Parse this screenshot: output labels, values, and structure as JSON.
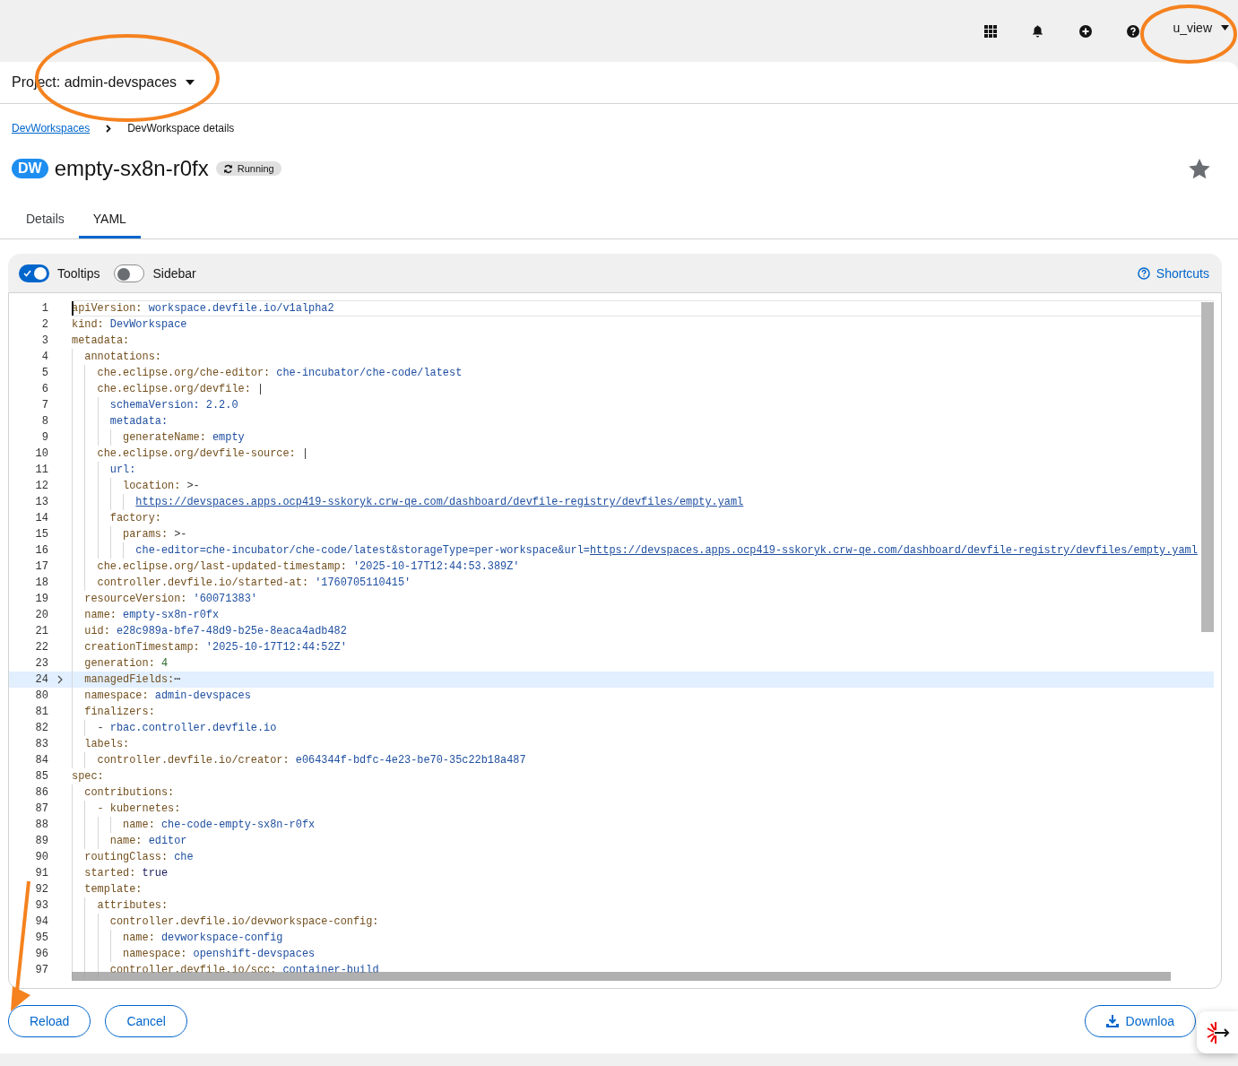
{
  "masthead": {
    "user": "u_view"
  },
  "project": {
    "label": "Project: admin-devspaces"
  },
  "breadcrumb": [
    {
      "label": "DevWorkspaces",
      "kind": "link"
    },
    {
      "label": "DevWorkspace details",
      "kind": "current"
    }
  ],
  "header": {
    "badge": "DW",
    "title": "empty-sx8n-r0fx",
    "status": "Running",
    "favorite": false
  },
  "tabs": [
    {
      "label": "Details",
      "selected": false
    },
    {
      "label": "YAML",
      "selected": true
    }
  ],
  "toolbar": {
    "toggles": [
      {
        "label": "Tooltips",
        "on": true
      },
      {
        "label": "Sidebar",
        "on": false
      }
    ],
    "shortcuts": "Shortcuts"
  },
  "editor": {
    "lines": [
      {
        "number": "1",
        "selected": true,
        "parts": [
          {
            "text": "apiVersion: ",
            "kind": "key"
          },
          {
            "text": "workspace.devfile.io/v1alpha2",
            "kind": "str"
          }
        ]
      },
      {
        "number": "2",
        "selected": false,
        "parts": [
          {
            "text": "kind: ",
            "kind": "key"
          },
          {
            "text": "DevWorkspace",
            "kind": "str"
          }
        ]
      },
      {
        "number": "3",
        "selected": false,
        "parts": [
          {
            "text": "metadata:",
            "kind": "key"
          }
        ]
      },
      {
        "number": "4",
        "selected": false,
        "parts": [
          {
            "text": "  annotations:",
            "kind": "key"
          }
        ]
      },
      {
        "number": "5",
        "selected": false,
        "parts": [
          {
            "text": "    che.eclipse.org/che-editor: ",
            "kind": "key"
          },
          {
            "text": "che-incubator/che-code/latest",
            "kind": "str"
          }
        ]
      },
      {
        "number": "6",
        "selected": false,
        "parts": [
          {
            "text": "    che.eclipse.org/devfile: ",
            "kind": "key"
          },
          {
            "text": "|",
            "kind": "plain"
          }
        ]
      },
      {
        "number": "7",
        "selected": false,
        "parts": [
          {
            "text": "      schemaVersion: 2.2.0",
            "kind": "str"
          }
        ]
      },
      {
        "number": "8",
        "selected": false,
        "parts": [
          {
            "text": "      metadata:",
            "kind": "str"
          }
        ]
      },
      {
        "number": "9",
        "selected": false,
        "parts": [
          {
            "text": "        generateName: ",
            "kind": "key"
          },
          {
            "text": "empty",
            "kind": "str"
          }
        ]
      },
      {
        "number": "10",
        "selected": false,
        "parts": [
          {
            "text": "    che.eclipse.org/devfile-source: ",
            "kind": "key"
          },
          {
            "text": "|",
            "kind": "plain"
          }
        ]
      },
      {
        "number": "11",
        "selected": false,
        "parts": [
          {
            "text": "      url:",
            "kind": "str"
          }
        ]
      },
      {
        "number": "12",
        "selected": false,
        "parts": [
          {
            "text": "        location: ",
            "kind": "key"
          },
          {
            "text": ">-",
            "kind": "plain"
          }
        ]
      },
      {
        "number": "13",
        "selected": false,
        "parts": [
          {
            "text": "          https://devspaces.apps.ocp419-sskoryk.crw-qe.com/dashboard/devfile-registry/devfiles/empty.yaml",
            "kind": "link"
          }
        ]
      },
      {
        "number": "14",
        "selected": false,
        "parts": [
          {
            "text": "      factory:",
            "kind": "key"
          }
        ]
      },
      {
        "number": "15",
        "selected": false,
        "parts": [
          {
            "text": "        params: ",
            "kind": "key"
          },
          {
            "text": ">-",
            "kind": "plain"
          }
        ]
      },
      {
        "number": "16",
        "selected": false,
        "parts": [
          {
            "text": "          che-editor=che-incubator/che-code/latest&storageType=per-workspace&url=",
            "kind": "str"
          },
          {
            "text": "https://devspaces.apps.ocp419-sskoryk.crw-qe.com/dashboard/devfile-registry/devfiles/empty.yaml",
            "kind": "link"
          }
        ]
      },
      {
        "number": "17",
        "selected": false,
        "parts": [
          {
            "text": "    che.eclipse.org/last-updated-timestamp: ",
            "kind": "key"
          },
          {
            "text": "'2025-10-17T12:44:53.389Z'",
            "kind": "str"
          }
        ]
      },
      {
        "number": "18",
        "selected": false,
        "parts": [
          {
            "text": "    controller.devfile.io/started-at: ",
            "kind": "key"
          },
          {
            "text": "'1760705110415'",
            "kind": "str"
          }
        ]
      },
      {
        "number": "19",
        "selected": false,
        "parts": [
          {
            "text": "  resourceVersion: ",
            "kind": "key"
          },
          {
            "text": "'60071383'",
            "kind": "str"
          }
        ]
      },
      {
        "number": "20",
        "selected": false,
        "parts": [
          {
            "text": "  name: ",
            "kind": "key"
          },
          {
            "text": "empty-sx8n-r0fx",
            "kind": "str"
          }
        ]
      },
      {
        "number": "21",
        "selected": false,
        "parts": [
          {
            "text": "  uid: ",
            "kind": "key"
          },
          {
            "text": "e28c989a-bfe7-48d9-b25e-8eaca4adb482",
            "kind": "str"
          }
        ]
      },
      {
        "number": "22",
        "selected": false,
        "parts": [
          {
            "text": "  creationTimestamp: ",
            "kind": "key"
          },
          {
            "text": "'2025-10-17T12:44:52Z'",
            "kind": "str"
          }
        ]
      },
      {
        "number": "23",
        "selected": false,
        "parts": [
          {
            "text": "  generation: ",
            "kind": "key"
          },
          {
            "text": "4",
            "kind": "num"
          }
        ]
      },
      {
        "number": "24",
        "selected": false,
        "folded": true,
        "parts": [
          {
            "text": "  managedFields:",
            "kind": "key"
          },
          {
            "text": "⋯",
            "kind": "plain"
          }
        ]
      },
      {
        "number": "80",
        "selected": false,
        "parts": [
          {
            "text": "  namespace: ",
            "kind": "key"
          },
          {
            "text": "admin-devspaces",
            "kind": "str"
          }
        ]
      },
      {
        "number": "81",
        "selected": false,
        "parts": [
          {
            "text": "  finalizers:",
            "kind": "key"
          }
        ]
      },
      {
        "number": "82",
        "selected": false,
        "parts": [
          {
            "text": "    - ",
            "kind": "plain"
          },
          {
            "text": "rbac.controller.devfile.io",
            "kind": "str"
          }
        ]
      },
      {
        "number": "83",
        "selected": false,
        "parts": [
          {
            "text": "  labels:",
            "kind": "key"
          }
        ]
      },
      {
        "number": "84",
        "selected": false,
        "parts": [
          {
            "text": "    controller.devfile.io/creator: ",
            "kind": "key"
          },
          {
            "text": "e064344f-bdfc-4e23-be70-35c22b18a487",
            "kind": "str"
          }
        ]
      },
      {
        "number": "85",
        "selected": false,
        "parts": [
          {
            "text": "spec:",
            "kind": "key"
          }
        ]
      },
      {
        "number": "86",
        "selected": false,
        "parts": [
          {
            "text": "  contributions:",
            "kind": "key"
          }
        ]
      },
      {
        "number": "87",
        "selected": false,
        "parts": [
          {
            "text": "    - kubernetes:",
            "kind": "key"
          }
        ]
      },
      {
        "number": "88",
        "selected": false,
        "parts": [
          {
            "text": "        name: ",
            "kind": "key"
          },
          {
            "text": "che-code-empty-sx8n-r0fx",
            "kind": "str"
          }
        ]
      },
      {
        "number": "89",
        "selected": false,
        "parts": [
          {
            "text": "      name: ",
            "kind": "key"
          },
          {
            "text": "editor",
            "kind": "str"
          }
        ]
      },
      {
        "number": "90",
        "selected": false,
        "parts": [
          {
            "text": "  routingClass: ",
            "kind": "key"
          },
          {
            "text": "che",
            "kind": "str"
          }
        ]
      },
      {
        "number": "91",
        "selected": false,
        "parts": [
          {
            "text": "  started: ",
            "kind": "key"
          },
          {
            "text": "true",
            "kind": "bool"
          }
        ]
      },
      {
        "number": "92",
        "selected": false,
        "parts": [
          {
            "text": "  template:",
            "kind": "key"
          }
        ]
      },
      {
        "number": "93",
        "selected": false,
        "parts": [
          {
            "text": "    attributes:",
            "kind": "key"
          }
        ]
      },
      {
        "number": "94",
        "selected": false,
        "parts": [
          {
            "text": "      controller.devfile.io/devworkspace-config:",
            "kind": "key"
          }
        ]
      },
      {
        "number": "95",
        "selected": false,
        "parts": [
          {
            "text": "        name: ",
            "kind": "key"
          },
          {
            "text": "devworkspace-config",
            "kind": "str"
          }
        ]
      },
      {
        "number": "96",
        "selected": false,
        "parts": [
          {
            "text": "        namespace: ",
            "kind": "key"
          },
          {
            "text": "openshift-devspaces",
            "kind": "str"
          }
        ]
      },
      {
        "number": "97",
        "selected": false,
        "parts": [
          {
            "text": "      controller.devfile.io/scc: ",
            "kind": "key"
          },
          {
            "text": "container-build",
            "kind": "str"
          }
        ]
      }
    ]
  },
  "actions": [
    {
      "label": "Reload",
      "kind": "secondary"
    },
    {
      "label": "Cancel",
      "kind": "secondary"
    },
    {
      "label": "Downloa",
      "kind": "download"
    }
  ]
}
